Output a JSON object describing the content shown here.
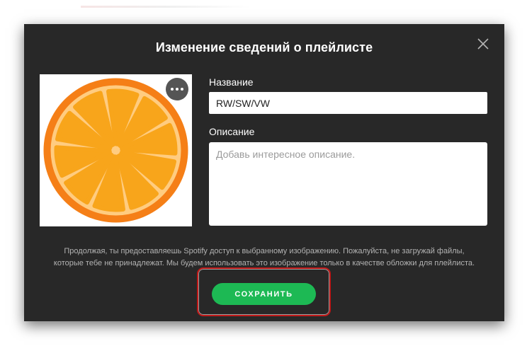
{
  "dialog": {
    "title": "Изменение сведений о плейлисте",
    "close_icon": "close-icon"
  },
  "cover": {
    "image": "orange-slice-cover",
    "more_icon": "more-options-icon",
    "colors": {
      "rind": "#f57f17",
      "pith": "#ffcc80",
      "segment": "#f8a51b"
    }
  },
  "form": {
    "name_label": "Название",
    "name_value": "RW/SW/VW",
    "description_label": "Описание",
    "description_placeholder": "Добавь интересное описание."
  },
  "disclaimer": {
    "line1": "Продолжая, ты предоставляешь Spotify доступ к выбранному изображению. Пожалуйста, не загружай файлы,",
    "line2": "которые тебе не принадлежат. Мы будем использовать это изображение только в качестве обложки для плейлиста."
  },
  "actions": {
    "save_label": "СОХРАНИТЬ",
    "accent_color": "#1db954",
    "highlight_color": "#c01818"
  }
}
